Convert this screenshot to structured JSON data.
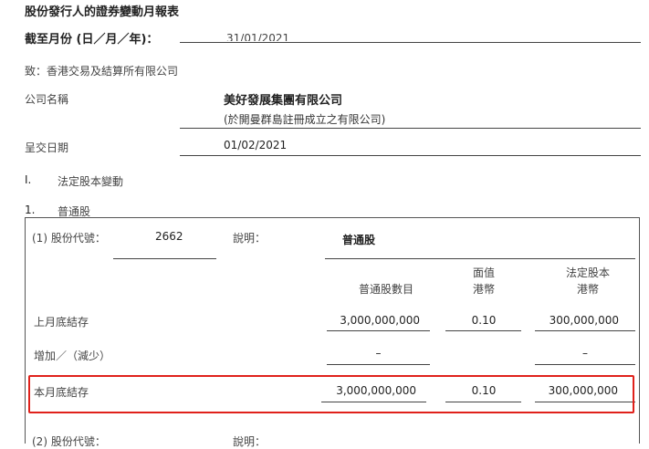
{
  "form_title": "股份發行人的證券變動月報表",
  "period_label": "截至月份 (日／月／年)：",
  "period_value": "31/01/2021",
  "to_line": "致：香港交易及結算所有限公司",
  "company_name_label": "公司名稱",
  "company_name": "美好發展集團有限公司",
  "company_note": "(於開曼群島註冊成立之有限公司)",
  "submission_date_label": "呈交日期",
  "submission_date": "01/02/2021",
  "section_1": {
    "number": "I.",
    "title": "法定股本變動"
  },
  "subsection_1": {
    "number": "1.",
    "title": "普通股"
  },
  "class_1": {
    "code_label": "(1) 股份代號：",
    "code_value": "2662",
    "desc_label": "說明：",
    "desc_value": "普通股"
  },
  "columns": {
    "shares": "普通股數目",
    "par_line1": "面值",
    "par_line2": "港幣",
    "capital_line1": "法定股本",
    "capital_line2": "港幣"
  },
  "rows": [
    {
      "label": "上月底結存",
      "shares": "3,000,000,000",
      "par": "0.10",
      "capital": "300,000,000"
    },
    {
      "label": "增加／（減少）",
      "shares": "–",
      "par": "",
      "capital": "–"
    },
    {
      "label": "本月底結存",
      "shares": "3,000,000,000",
      "par": "0.10",
      "capital": "300,000,000"
    }
  ],
  "class_2": {
    "code_label": "(2) 股份代號：",
    "desc_label": "說明："
  },
  "highlight_color": "#e0211b"
}
